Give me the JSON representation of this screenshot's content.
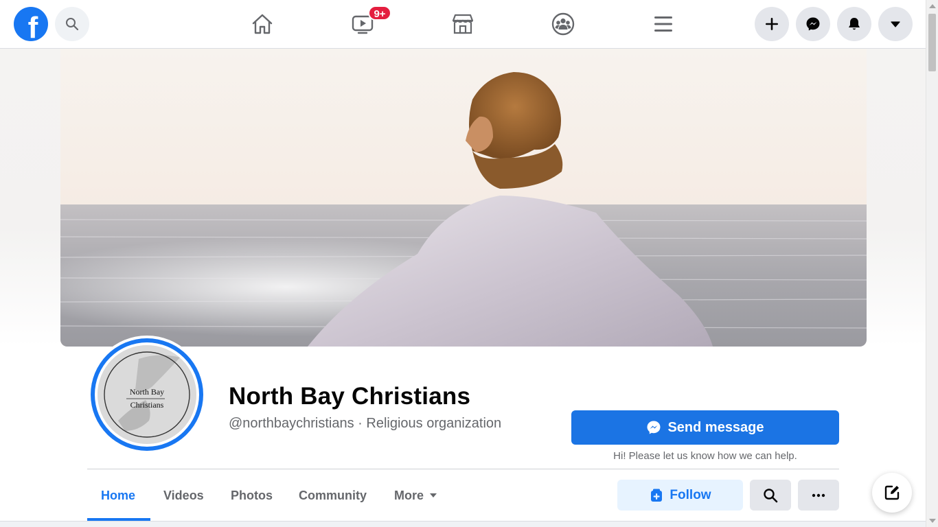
{
  "topbar": {
    "logo_letter": "f",
    "watch_badge": "9+"
  },
  "page": {
    "name": "North Bay Christians",
    "subtitle": "@northbaychristians · Religious organization",
    "avatar_text_line1": "North Bay",
    "avatar_text_line2": "Christians"
  },
  "actions": {
    "send_message_label": "Send message",
    "help_text": "Hi! Please let us know how we can help.",
    "follow_label": "Follow"
  },
  "tabs": [
    {
      "label": "Home",
      "active": true
    },
    {
      "label": "Videos"
    },
    {
      "label": "Photos"
    },
    {
      "label": "Community"
    },
    {
      "label": "More"
    }
  ],
  "colors": {
    "brand": "#1877f2",
    "badge": "#e41e3f",
    "follow_bg": "#e7f3ff"
  },
  "icons": [
    "facebook-logo-icon",
    "search-icon",
    "home-icon",
    "watch-icon",
    "marketplace-icon",
    "groups-icon",
    "menu-icon",
    "plus-icon",
    "messenger-icon",
    "bell-icon",
    "caret-down-icon",
    "compose-icon"
  ]
}
